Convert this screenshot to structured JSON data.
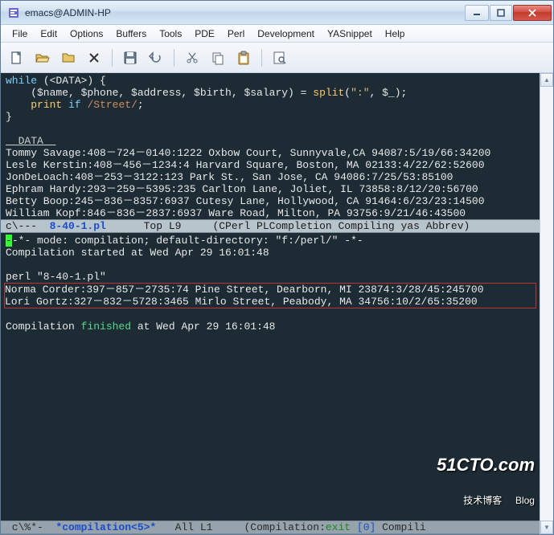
{
  "window": {
    "title": "emacs@ADMIN-HP"
  },
  "menu": [
    "File",
    "Edit",
    "Options",
    "Buffers",
    "Tools",
    "PDE",
    "Perl",
    "Development",
    "YASnippet",
    "Help"
  ],
  "code": {
    "l1a": "while",
    "l1b": " (<DATA>) {",
    "l2a": "    ($name, $phone, $address, $birth, $salary) = ",
    "l2b": "split",
    "l2c": "(",
    "l2d": "\":\"",
    "l2e": ", $_);",
    "l3a": "    ",
    "l3b": "print",
    "l3c": " ",
    "l3d": "if",
    "l3e": " ",
    "l3f": "/Street/",
    "l3g": ";",
    "l4": "}",
    "l5": "",
    "l6": "__DATA__",
    "d1": "Tommy Savage:408－724－0140:1222 Oxbow Court, Sunnyvale,CA 94087:5/19/66:34200",
    "d2": "Lesle Kerstin:408－456－1234:4 Harvard Square, Boston, MA 02133:4/22/62:52600",
    "d3": "JonDeLoach:408－253－3122:123 Park St., San Jose, CA 94086:7/25/53:85100",
    "d4": "Ephram Hardy:293－259－5395:235 Carlton Lane, Joliet, IL 73858:8/12/20:56700",
    "d5": "Betty Boop:245－836－8357:6937 Cutesy Lane, Hollywood, CA 91464:6/23/23:14500",
    "d6": "William Kopf:846－836－2837:6937 Ware Road, Milton, PA 93756:9/21/46:43500"
  },
  "modeline_top": {
    "left": "c\\---  ",
    "file": "8-40-1.pl",
    "mid": "      Top L9     (CPerl PLCompletion Compiling yas Abbrev)"
  },
  "compilation": {
    "l1": "-*- mode: compilation; default-directory: \"f:/perl/\" -*-",
    "l2": "Compilation started at Wed Apr 29 16:01:48",
    "l3": "",
    "l4": "perl \"8-40-1.pl\"",
    "h1": "Norma Corder:397－857－2735:74 Pine Street, Dearborn, MI 23874:3/28/45:245700",
    "h2": "Lori Gortz:327－832－5728:3465 Mirlo Street, Peabody, MA 34756:10/2/65:35200",
    "l7a": "Compilation ",
    "l7b": "finished",
    "l7c": " at Wed Apr 29 16:01:48"
  },
  "modeline_bot": {
    "left": " c\\%*-  ",
    "buf": "*compilation<5>*",
    "mid": "   All L1     (Compilation:",
    "exit": "exit",
    "num": " [0]",
    "rest": " Compili"
  },
  "watermark": {
    "big": "51CTO.com",
    "small": "技术博客     Blog"
  }
}
